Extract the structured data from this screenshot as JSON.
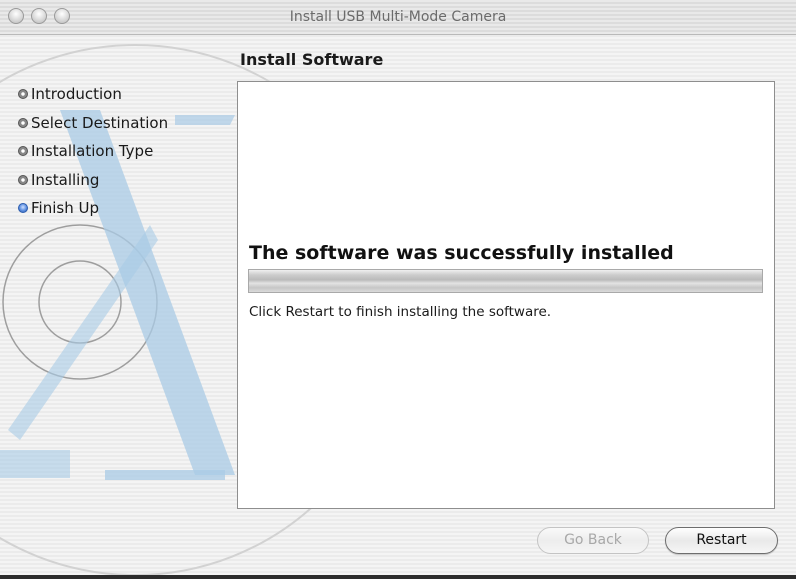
{
  "window": {
    "title": "Install USB Multi-Mode Camera"
  },
  "header": {
    "section_title": "Install Software"
  },
  "sidebar": {
    "steps": [
      {
        "label": "Introduction",
        "current": false
      },
      {
        "label": "Select Destination",
        "current": false
      },
      {
        "label": "Installation Type",
        "current": false
      },
      {
        "label": "Installing",
        "current": false
      },
      {
        "label": "Finish Up",
        "current": true
      }
    ]
  },
  "main": {
    "heading": "The software was successfully installed",
    "progress": 1.0,
    "instruction": "Click Restart to finish installing the software."
  },
  "buttons": {
    "go_back": "Go Back",
    "restart": "Restart"
  },
  "colors": {
    "current_step": "#2c5cae",
    "background_art": "#a9cbe6"
  }
}
